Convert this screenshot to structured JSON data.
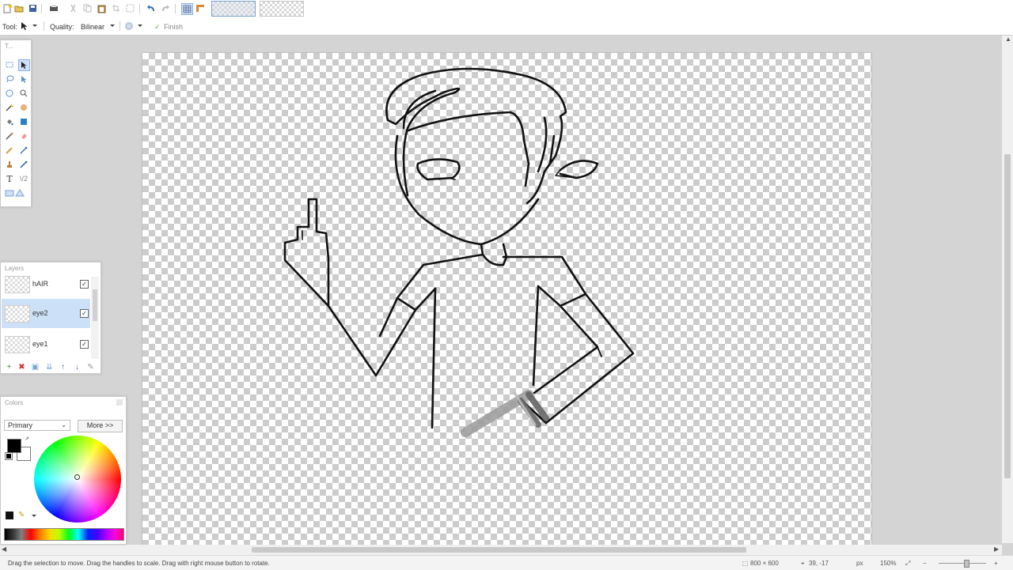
{
  "toolbar": {
    "buttons": [
      "new-icon",
      "open-icon",
      "save-icon",
      "print-icon",
      "cut-icon",
      "copy-icon",
      "paste-icon",
      "crop-icon",
      "deselect-icon",
      "select-all-icon",
      "undo-icon",
      "redo-icon",
      "grid-icon",
      "ruler-icon"
    ],
    "image_tabs": 2
  },
  "tool_options": {
    "tool_label": "Tool:",
    "quality_label": "Quality:",
    "quality_value": "Bilinear",
    "finish_label": "Finish"
  },
  "tools_panel": {
    "title": "T..."
  },
  "layers_panel": {
    "title": "Layers",
    "layers": [
      {
        "name": "hAIR",
        "visible": true,
        "selected": false
      },
      {
        "name": "eye2",
        "visible": true,
        "selected": true
      },
      {
        "name": "eye1",
        "visible": true,
        "selected": false
      }
    ]
  },
  "colors_panel": {
    "title": "Colors",
    "mode": "Primary",
    "more_label": "More >>",
    "primary_color": "#000000",
    "secondary_color": "#ffffff"
  },
  "status": {
    "hint": "Drag the selection to move. Drag the handles to scale. Drag with right mouse button to rotate.",
    "image_size": "800 × 600",
    "cursor_pos": "39, -17",
    "unit": "px",
    "zoom": "150%"
  }
}
